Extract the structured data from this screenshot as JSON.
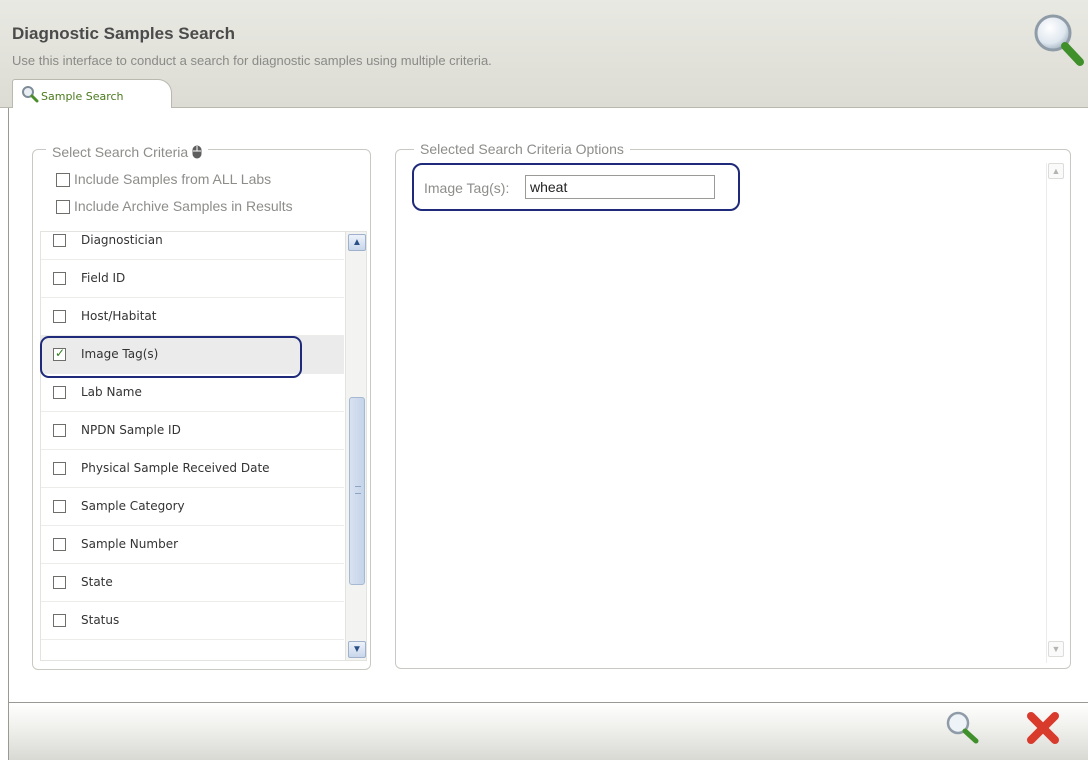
{
  "header": {
    "title": "Diagnostic Samples Search",
    "subtitle": "Use this interface to conduct a search for diagnostic samples using multiple criteria."
  },
  "tabs": [
    {
      "label": "Sample Search",
      "icon": "search-icon"
    }
  ],
  "left_panel": {
    "legend": "Select Search Criteria",
    "legend_icon": "mouse-icon",
    "options": [
      {
        "label": "Include Samples from ALL Labs",
        "checked": false
      },
      {
        "label": "Include Archive Samples in Results",
        "checked": false
      }
    ],
    "criteria": [
      {
        "label": "Diagnostician",
        "checked": false
      },
      {
        "label": "Field ID",
        "checked": false
      },
      {
        "label": "Host/Habitat",
        "checked": false
      },
      {
        "label": "Image Tag(s)",
        "checked": true
      },
      {
        "label": "Lab Name",
        "checked": false
      },
      {
        "label": "NPDN Sample ID",
        "checked": false
      },
      {
        "label": "Physical Sample Received Date",
        "checked": false
      },
      {
        "label": "Sample Category",
        "checked": false
      },
      {
        "label": "Sample Number",
        "checked": false
      },
      {
        "label": "State",
        "checked": false
      },
      {
        "label": "Status",
        "checked": false
      }
    ]
  },
  "right_panel": {
    "legend": "Selected Search Criteria Options",
    "image_tag_label": "Image Tag(s):",
    "image_tag_value": "wheat"
  },
  "footer": {
    "search_icon": "search-icon",
    "cancel_icon": "cancel-icon"
  },
  "colors": {
    "tab_text": "#4a7a1c",
    "highlight_border": "#1f2b7a",
    "cancel_red": "#d83a2c"
  }
}
